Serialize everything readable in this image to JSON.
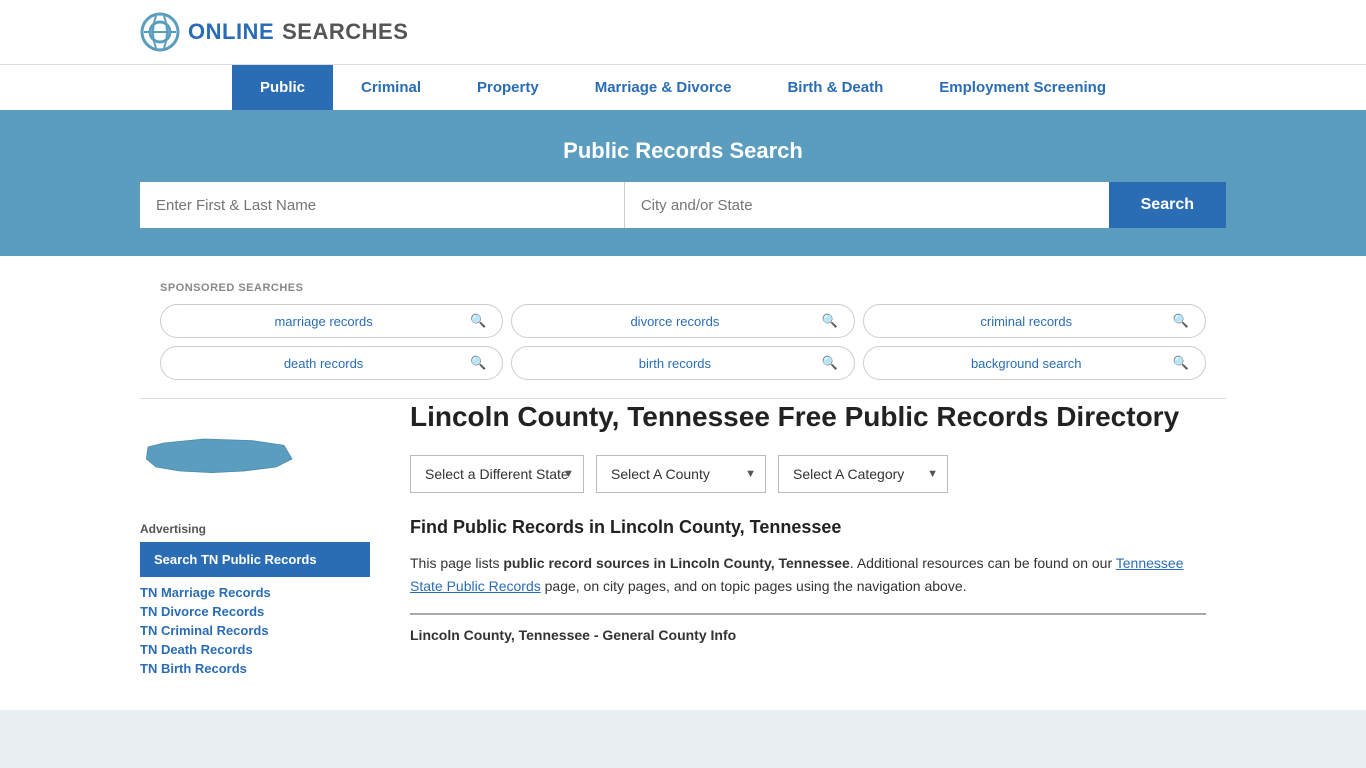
{
  "logo": {
    "text_online": "ONLINE",
    "text_searches": "SEARCHES",
    "icon_label": "online-searches-logo"
  },
  "nav": {
    "items": [
      {
        "label": "Public",
        "active": true
      },
      {
        "label": "Criminal",
        "active": false
      },
      {
        "label": "Property",
        "active": false
      },
      {
        "label": "Marriage & Divorce",
        "active": false
      },
      {
        "label": "Birth & Death",
        "active": false
      },
      {
        "label": "Employment Screening",
        "active": false
      }
    ]
  },
  "hero": {
    "title": "Public Records Search",
    "name_placeholder": "Enter First & Last Name",
    "location_placeholder": "City and/or State",
    "search_button": "Search"
  },
  "sponsored": {
    "label": "SPONSORED SEARCHES",
    "tags": [
      {
        "text": "marriage records"
      },
      {
        "text": "divorce records"
      },
      {
        "text": "criminal records"
      },
      {
        "text": "death records"
      },
      {
        "text": "birth records"
      },
      {
        "text": "background search"
      }
    ]
  },
  "sidebar": {
    "advertising_label": "Advertising",
    "ad_box_text": "Search TN Public Records",
    "links": [
      "TN Marriage Records",
      "TN Divorce Records",
      "TN Criminal Records",
      "TN Death Records",
      "TN Birth Records"
    ]
  },
  "main": {
    "page_title": "Lincoln County, Tennessee Free Public Records Directory",
    "dropdowns": {
      "state_label": "Select a Different State",
      "county_label": "Select A County",
      "category_label": "Select A Category"
    },
    "section_heading": "Find Public Records in Lincoln County, Tennessee",
    "description": "This page lists public record sources in Lincoln County, Tennessee. Additional resources can be found on our Tennessee State Public Records page, on city pages, and on topic pages using the navigation above.",
    "description_link": "Tennessee State Public Records",
    "info_box_title": "Lincoln County, Tennessee - General County Info"
  }
}
